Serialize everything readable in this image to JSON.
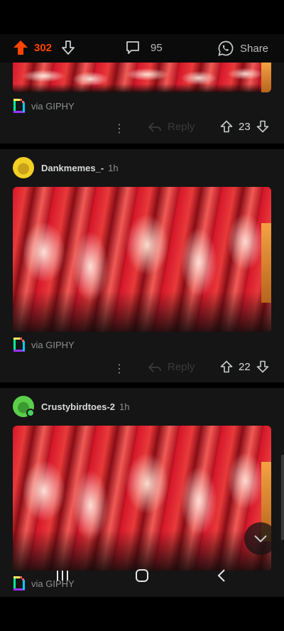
{
  "post_bar": {
    "upvotes": "302",
    "comments": "95",
    "share_label": "Share"
  },
  "comments": [
    {
      "partial": true,
      "via": "via GIPHY",
      "reply_label": "Reply",
      "votes": "23"
    },
    {
      "username": "Dankmemes_-",
      "time": "1h",
      "via": "via GIPHY",
      "reply_label": "Reply",
      "votes": "22"
    },
    {
      "username": "Crustybirdtoes-2",
      "time": "1h",
      "via": "via GIPHY"
    }
  ],
  "colors": {
    "upvote_orange": "#ff4500",
    "background": "#151515",
    "gif_red": "#d5152a",
    "online_green": "#46d160"
  },
  "icons": {
    "upvote": "arrow-up-icon",
    "downvote": "arrow-down-icon",
    "comment": "comment-bubble-icon",
    "share": "whatsapp-icon",
    "giphy": "giphy-logo-icon",
    "more": "more-dots-icon",
    "reply": "reply-arrow-icon",
    "scroll_down": "chevron-down-icon",
    "nav_recents": "recents-icon",
    "nav_home": "home-icon",
    "nav_back": "back-icon"
  }
}
